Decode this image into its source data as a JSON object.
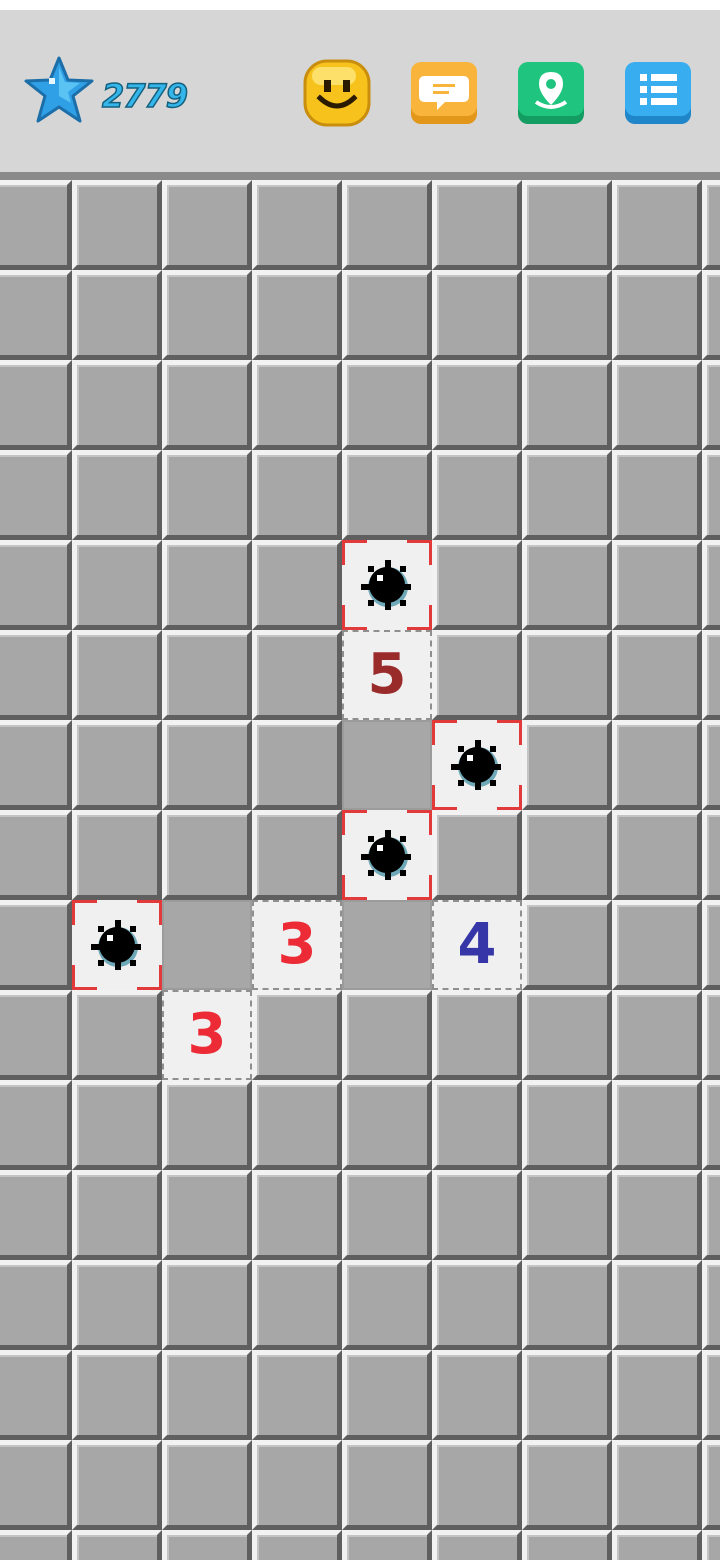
{
  "header": {
    "score": "2779",
    "icons": [
      "star-icon",
      "smiley-face-icon",
      "chat-bubble-icon",
      "location-pin-icon",
      "menu-list-icon"
    ]
  },
  "colors": {
    "score_text": "#35b6ea",
    "number_3": "#ec2b37",
    "number_4": "#3636a8",
    "number_5": "#9a2b2b",
    "mine_border": "#e23a3a",
    "covered_tile": "#a7a7a7",
    "revealed_tile": "#f0f0f0"
  },
  "board": {
    "columns": 8,
    "visible_rows": 16,
    "cells": [
      {
        "row": 4,
        "col": 4,
        "state": "mine"
      },
      {
        "row": 5,
        "col": 4,
        "state": "number",
        "value": "5",
        "color": "#9a2b2b"
      },
      {
        "row": 6,
        "col": 4,
        "state": "blank"
      },
      {
        "row": 6,
        "col": 5,
        "state": "mine"
      },
      {
        "row": 7,
        "col": 4,
        "state": "mine"
      },
      {
        "row": 8,
        "col": 1,
        "state": "mine"
      },
      {
        "row": 8,
        "col": 2,
        "state": "blank"
      },
      {
        "row": 8,
        "col": 3,
        "state": "number",
        "value": "3",
        "color": "#ec2b37"
      },
      {
        "row": 8,
        "col": 4,
        "state": "blank"
      },
      {
        "row": 8,
        "col": 5,
        "state": "number",
        "value": "4",
        "color": "#3636a8"
      },
      {
        "row": 9,
        "col": 2,
        "state": "number",
        "value": "3",
        "color": "#ec2b37"
      }
    ]
  }
}
